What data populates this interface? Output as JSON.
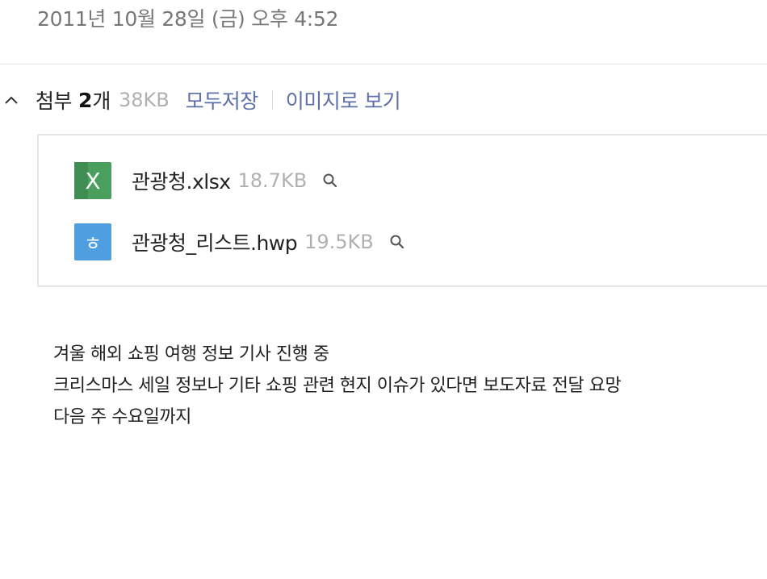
{
  "header": {
    "date": "2011년 10월 28일 (금) 오후 4:52"
  },
  "attachments": {
    "label": "첨부",
    "count": "2",
    "unit": "개",
    "total_size": "38KB",
    "save_all": "모두저장",
    "view_as_images": "이미지로 보기",
    "files": [
      {
        "name": "관광청.xlsx",
        "size": "18.7KB",
        "icon": "excel-file-icon",
        "icon_color": "#4a9f5f",
        "icon_glyph": "X"
      },
      {
        "name": "관광청_리스트.hwp",
        "size": "19.5KB",
        "icon": "hwp-file-icon",
        "icon_color": "#4f9fe0",
        "icon_glyph": "ㅎ"
      }
    ]
  },
  "message": {
    "lines": [
      "겨울 해외 쇼핑 여행 정보 기사 진행 중",
      "크리스마스 세일 정보나 기타 쇼핑 관련 현지 이슈가 있다면 보도자료 전달 요망",
      "다음 주 수요일까지"
    ]
  },
  "colors": {
    "link": "#5d6fa8",
    "muted": "#b0b0b0",
    "date": "#777777"
  }
}
